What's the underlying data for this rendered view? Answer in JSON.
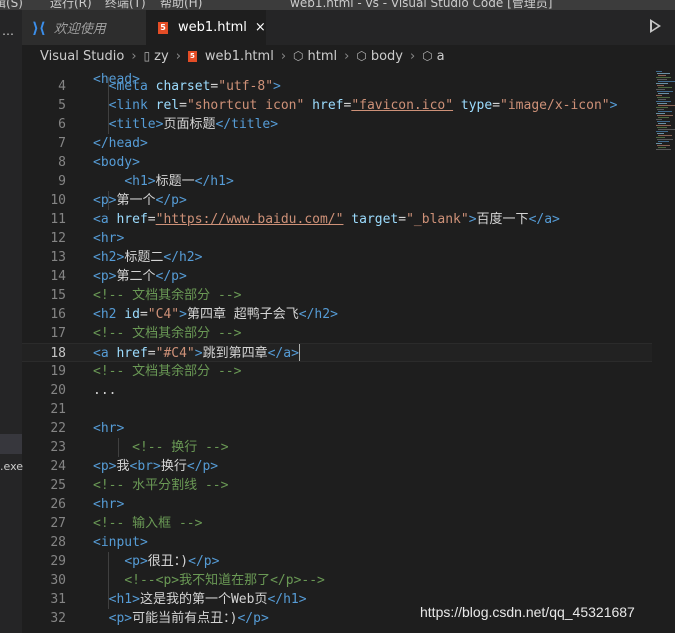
{
  "menubar": {
    "items": [
      "辑(S)",
      "运行(R)",
      "终端(T)",
      "帮助(H)"
    ],
    "title": "web1.html - vs - Visual Studio Code [管理员]"
  },
  "sidebar": {
    "partial_dots": "…",
    "partial_item": ".exe"
  },
  "tabs": [
    {
      "label": "欢迎使用",
      "icon": "vscode-icon",
      "active": false
    },
    {
      "label": "web1.html",
      "icon": "html5-icon",
      "active": true,
      "close": "×"
    }
  ],
  "breadcrumb": [
    "Visual Studio",
    "zy",
    "web1.html",
    "html",
    "body",
    "a"
  ],
  "editor": {
    "top_partial": "<head>",
    "lines": [
      {
        "n": "4",
        "tokens": [
          [
            "  ",
            ""
          ],
          [
            "<meta",
            ""
          ],
          [
            " charset",
            "at"
          ],
          [
            "=",
            ""
          ],
          [
            "\"utf-8\"",
            "st"
          ],
          [
            ">",
            "tg"
          ]
        ]
      },
      {
        "n": "5",
        "tokens": [
          [
            "  ",
            ""
          ],
          [
            "<link",
            ""
          ],
          [
            " rel",
            "at"
          ],
          [
            "=",
            ""
          ],
          [
            "\"shortcut icon\"",
            "st"
          ],
          [
            " href",
            "at"
          ],
          [
            "=",
            ""
          ],
          [
            "\"favicon.ico\"",
            "st link"
          ],
          [
            " type",
            "at"
          ],
          [
            "=",
            ""
          ],
          [
            "\"image/x-icon\"",
            "st"
          ],
          [
            ">",
            "tg"
          ]
        ]
      },
      {
        "n": "6",
        "tokens": [
          [
            "  ",
            ""
          ],
          [
            "<title>",
            ""
          ],
          [
            "页面标题",
            ""
          ],
          [
            "</title>",
            ""
          ]
        ]
      },
      {
        "n": "7",
        "tokens": [
          [
            "</head>",
            ""
          ]
        ]
      },
      {
        "n": "8",
        "tokens": [
          [
            "<body>",
            ""
          ]
        ]
      },
      {
        "n": "9",
        "tokens": [
          [
            "    ",
            ""
          ],
          [
            "<h1>",
            ""
          ],
          [
            "标题一",
            ""
          ],
          [
            "</h1>",
            ""
          ]
        ]
      },
      {
        "n": "10",
        "tokens": [
          [
            "<p>",
            ""
          ],
          [
            "第一个",
            ""
          ],
          [
            "</p>",
            ""
          ]
        ]
      },
      {
        "n": "11",
        "tokens": [
          [
            "<a",
            ""
          ],
          [
            " href",
            "at"
          ],
          [
            "=",
            ""
          ],
          [
            "\"https://www.baidu.com/\"",
            "st link"
          ],
          [
            " target",
            "at"
          ],
          [
            "=",
            ""
          ],
          [
            "\"_blank\"",
            "st"
          ],
          [
            ">",
            "tg"
          ],
          [
            "百度一下",
            ""
          ],
          [
            "</a>",
            ""
          ]
        ]
      },
      {
        "n": "12",
        "tokens": [
          [
            "<hr>",
            ""
          ]
        ]
      },
      {
        "n": "13",
        "tokens": [
          [
            "<h2>",
            ""
          ],
          [
            "标题二",
            ""
          ],
          [
            "</h2>",
            ""
          ]
        ]
      },
      {
        "n": "14",
        "tokens": [
          [
            "<p>",
            ""
          ],
          [
            "第二个",
            ""
          ],
          [
            "</p>",
            ""
          ]
        ]
      },
      {
        "n": "15",
        "tokens": [
          [
            "<!-- 文档其余部分 -->",
            "cm"
          ]
        ]
      },
      {
        "n": "16",
        "tokens": [
          [
            "<h2",
            ""
          ],
          [
            " id",
            "at"
          ],
          [
            "=",
            ""
          ],
          [
            "\"C4\"",
            "st"
          ],
          [
            ">",
            "tg"
          ],
          [
            "第四章 超鸭子会飞",
            ""
          ],
          [
            "</h2>",
            ""
          ]
        ]
      },
      {
        "n": "17",
        "tokens": [
          [
            "<!-- 文档其余部分 -->",
            "cm"
          ]
        ]
      },
      {
        "n": "18",
        "tokens": [
          [
            "<a",
            ""
          ],
          [
            " href",
            "at"
          ],
          [
            "=",
            ""
          ],
          [
            "\"#C4\"",
            "st"
          ],
          [
            ">",
            "tg"
          ],
          [
            "跳到第四章",
            ""
          ],
          [
            "</a>",
            ""
          ]
        ],
        "current": true
      },
      {
        "n": "19",
        "tokens": [
          [
            "<!-- 文档其余部分 -->",
            "cm"
          ]
        ]
      },
      {
        "n": "20",
        "tokens": [
          [
            "...",
            ""
          ]
        ]
      },
      {
        "n": "21",
        "tokens": []
      },
      {
        "n": "22",
        "tokens": [
          [
            "<hr>",
            ""
          ]
        ]
      },
      {
        "n": "23",
        "tokens": [
          [
            "     ",
            ""
          ],
          [
            "<!-- 换行 -->",
            "cm"
          ]
        ]
      },
      {
        "n": "24",
        "tokens": [
          [
            "<p>",
            ""
          ],
          [
            "我",
            ""
          ],
          [
            "<br>",
            ""
          ],
          [
            "换行",
            ""
          ],
          [
            "</p>",
            ""
          ]
        ]
      },
      {
        "n": "25",
        "tokens": [
          [
            "<!-- 水平分割线 -->",
            "cm"
          ]
        ]
      },
      {
        "n": "26",
        "tokens": [
          [
            "<hr>",
            ""
          ]
        ]
      },
      {
        "n": "27",
        "tokens": [
          [
            "<!-- 输入框 -->",
            "cm"
          ]
        ]
      },
      {
        "n": "28",
        "tokens": [
          [
            "<input>",
            ""
          ]
        ]
      },
      {
        "n": "29",
        "tokens": [
          [
            "    ",
            ""
          ],
          [
            "<p>",
            ""
          ],
          [
            "很丑：)",
            ""
          ],
          [
            "</p>",
            ""
          ]
        ]
      },
      {
        "n": "30",
        "tokens": [
          [
            "    ",
            ""
          ],
          [
            "<!--<p>我不知道在那了</p>-->",
            "cm"
          ]
        ]
      },
      {
        "n": "31",
        "tokens": [
          [
            "  ",
            ""
          ],
          [
            "<h1>",
            ""
          ],
          [
            "这是我的第一个Web页",
            ""
          ],
          [
            "</h1>",
            ""
          ]
        ]
      },
      {
        "n": "32",
        "tokens": [
          [
            "  ",
            ""
          ],
          [
            "<p>",
            ""
          ],
          [
            "可能当前有点丑：)",
            ""
          ],
          [
            "</p>",
            ""
          ]
        ]
      }
    ]
  },
  "watermark": "https://blog.csdn.net/qq_45321687",
  "colors": {
    "tag": "#569cd6",
    "attribute": "#9cdcfe",
    "string": "#ce9178",
    "comment": "#6a9955",
    "text": "#d4d4d4",
    "background": "#1e1e1e"
  }
}
